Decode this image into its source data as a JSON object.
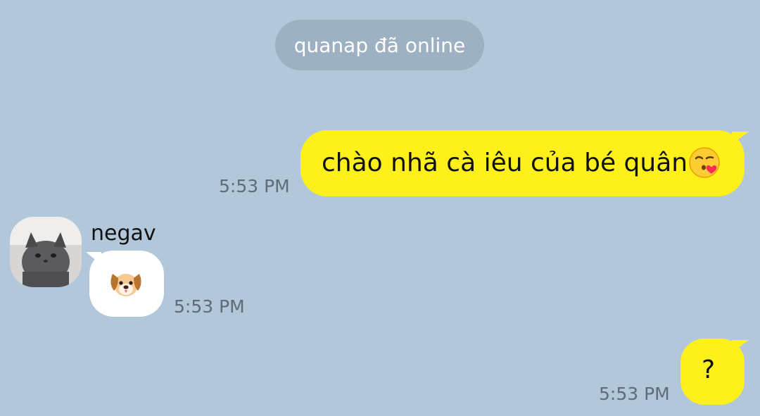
{
  "system_message": {
    "text": "quanap đã online"
  },
  "messages": [
    {
      "direction": "outgoing",
      "text": "chào nhã cà iêu của bé quân",
      "emoji_icon": "kissing-face-heart-icon",
      "time": "5:53 PM"
    },
    {
      "direction": "incoming",
      "sender_name": "negav",
      "avatar_icon": "cat-photo-avatar",
      "emoji_icon": "dog-face-icon",
      "time": "5:53 PM"
    },
    {
      "direction": "outgoing",
      "text": "?",
      "time": "5:53 PM"
    }
  ],
  "colors": {
    "background": "#b2c7da",
    "outgoing_bubble": "#fef01b",
    "incoming_bubble": "#ffffff",
    "system_pill": "#9eb1c3",
    "timestamp": "#5f6b77"
  }
}
